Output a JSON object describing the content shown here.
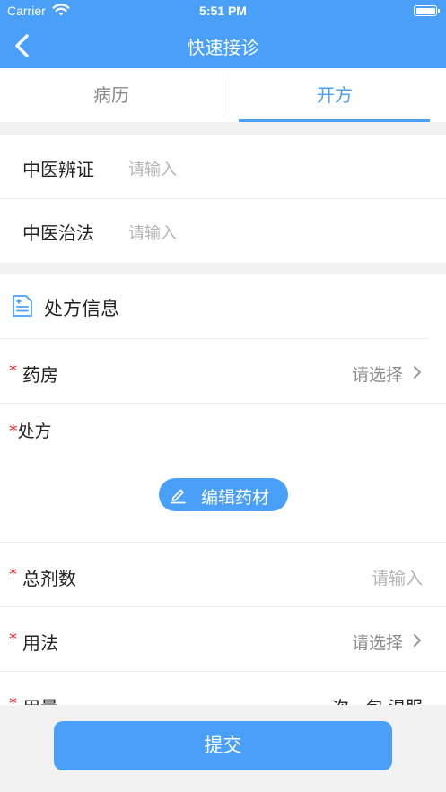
{
  "status_bar": {
    "carrier": "Carrier",
    "time": "5:51 PM"
  },
  "nav": {
    "title": "快速接诊"
  },
  "tabs": [
    {
      "label": "病历",
      "active": false
    },
    {
      "label": "开方",
      "active": true
    }
  ],
  "tcm": {
    "syndrome": {
      "label": "中医辨证",
      "placeholder": "请输入"
    },
    "treatment": {
      "label": "中医治法",
      "placeholder": "请输入"
    }
  },
  "prescription_info": {
    "title": "处方信息",
    "pharmacy": {
      "required": "*",
      "label": "药房",
      "value": "请选择"
    },
    "prescription": {
      "required": "*",
      "label": "处方",
      "edit_button": "编辑药材"
    },
    "total_doses": {
      "required": "*",
      "label": "总剂数",
      "placeholder": "请输入"
    },
    "usage": {
      "required": "*",
      "label": "用法",
      "value": "请选择"
    },
    "dosage": {
      "required": "*",
      "label": "用量",
      "value": "一次一包 温服"
    }
  },
  "submit": {
    "label": "提交"
  },
  "colors": {
    "primary": "#4aa0f8",
    "required": "#e02020",
    "placeholder": "#b5b5b5"
  }
}
